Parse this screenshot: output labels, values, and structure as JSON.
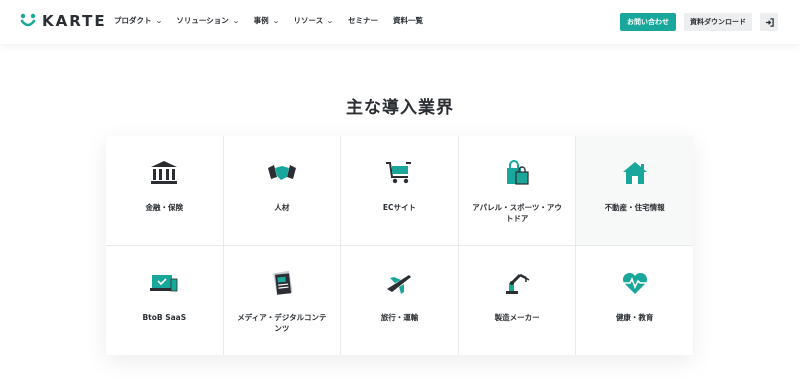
{
  "header": {
    "logo_text": "KARTE",
    "nav": [
      {
        "label": "プロダクト",
        "has_dropdown": true
      },
      {
        "label": "ソリューション",
        "has_dropdown": true
      },
      {
        "label": "事例",
        "has_dropdown": true
      },
      {
        "label": "リソース",
        "has_dropdown": true
      },
      {
        "label": "セミナー",
        "has_dropdown": false
      },
      {
        "label": "資料一覧",
        "has_dropdown": false
      }
    ],
    "contact_label": "お問い合わせ",
    "download_label": "資料ダウンロード",
    "login_icon": "login-icon"
  },
  "section": {
    "title": "主な導入業界",
    "industries": [
      {
        "label": "金融・保険",
        "icon": "bank-icon"
      },
      {
        "label": "人材",
        "icon": "handshake-icon"
      },
      {
        "label": "ECサイト",
        "icon": "cart-icon"
      },
      {
        "label": "アパレル・スポーツ・アウトドア",
        "icon": "shopping-bag-icon"
      },
      {
        "label": "不動産・住宅情報",
        "icon": "house-icon"
      },
      {
        "label": "BtoB SaaS",
        "icon": "laptop-icon"
      },
      {
        "label": "メディア・デジタルコンテンツ",
        "icon": "document-icon"
      },
      {
        "label": "旅行・運輸",
        "icon": "airplane-icon"
      },
      {
        "label": "製造メーカー",
        "icon": "robot-arm-icon"
      },
      {
        "label": "健康・教育",
        "icon": "heart-pulse-icon"
      }
    ]
  },
  "colors": {
    "accent": "#1aa79b",
    "dark": "#2b2f33"
  }
}
